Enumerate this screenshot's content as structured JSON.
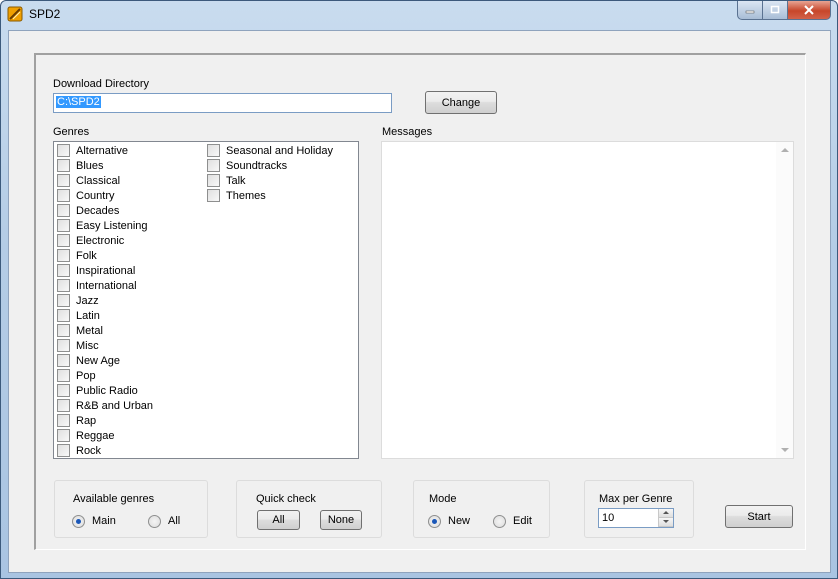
{
  "window": {
    "title": "SPD2"
  },
  "download": {
    "label": "Download Directory",
    "value": "C:\\SPD2",
    "change_label": "Change"
  },
  "genres": {
    "label": "Genres",
    "col1": [
      "Alternative",
      "Blues",
      "Classical",
      "Country",
      "Decades",
      "Easy Listening",
      "Electronic",
      "Folk",
      "Inspirational",
      "International",
      "Jazz",
      "Latin",
      "Metal",
      "Misc",
      "New Age",
      "Pop",
      "Public Radio",
      "R&B and Urban",
      "Rap",
      "Reggae",
      "Rock"
    ],
    "col2": [
      "Seasonal and Holiday",
      "Soundtracks",
      "Talk",
      "Themes"
    ]
  },
  "messages": {
    "label": "Messages"
  },
  "available": {
    "label": "Available genres",
    "options": [
      "Main",
      "All"
    ],
    "selected": "Main"
  },
  "quick": {
    "label": "Quick check",
    "all_label": "All",
    "none_label": "None"
  },
  "mode": {
    "label": "Mode",
    "options": [
      "New",
      "Edit"
    ],
    "selected": "New"
  },
  "max": {
    "label": "Max per Genre",
    "value": "10"
  },
  "start_label": "Start",
  "colors": {
    "title_bar": "#b5cde6",
    "selection": "#3399ff",
    "radio_dot": "#1a57b8"
  }
}
